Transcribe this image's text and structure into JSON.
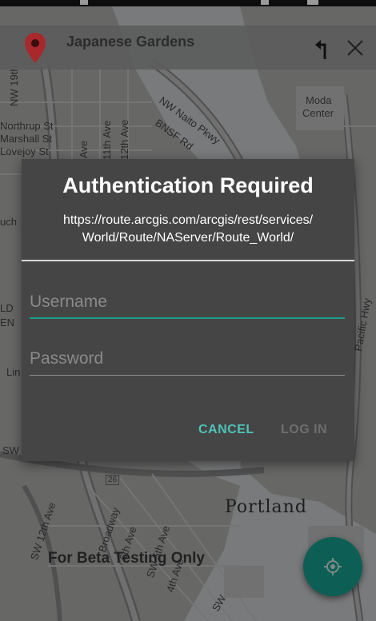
{
  "top_bar": {
    "title": "Japanese Gardens",
    "pin_icon": "map-pin-icon",
    "turn_icon": "turn-left-icon",
    "close_icon": "close-icon"
  },
  "map": {
    "city_label": "Portland",
    "watermark": "For Beta Testing Only",
    "place_labels": [
      "Moda",
      "Center"
    ],
    "street_labels": [
      "NW Naito Pkwy",
      "BNSF Rd",
      "NW 19th",
      "Northrup St",
      "Marshall St",
      "Lovejoy St",
      "Ave",
      "11th Ave",
      "12th Ave",
      "Pacific Hwy",
      "SW 12th Ave",
      "Broadway",
      "6th Ave",
      "SW 5th Ave",
      "4th Ave",
      "SW",
      "26",
      "Lin",
      "LD",
      "EN",
      "uch",
      "SW"
    ]
  },
  "dialog": {
    "title": "Authentication Required",
    "url_line1": "https://route.arcgis.com/arcgis/rest/services/",
    "url_line2": "World/Route/NAServer/Route_World/",
    "username_placeholder": "Username",
    "password_placeholder": "Password",
    "cancel_label": "CANCEL",
    "login_label": "LOG IN"
  },
  "colors": {
    "accent": "#1f9a8c",
    "cancel_text": "#4fc3b6",
    "fab": "#0d5f55",
    "dialog_bg": "#454545",
    "pin": "#a8282c"
  },
  "fab": {
    "icon": "my-location-icon"
  }
}
